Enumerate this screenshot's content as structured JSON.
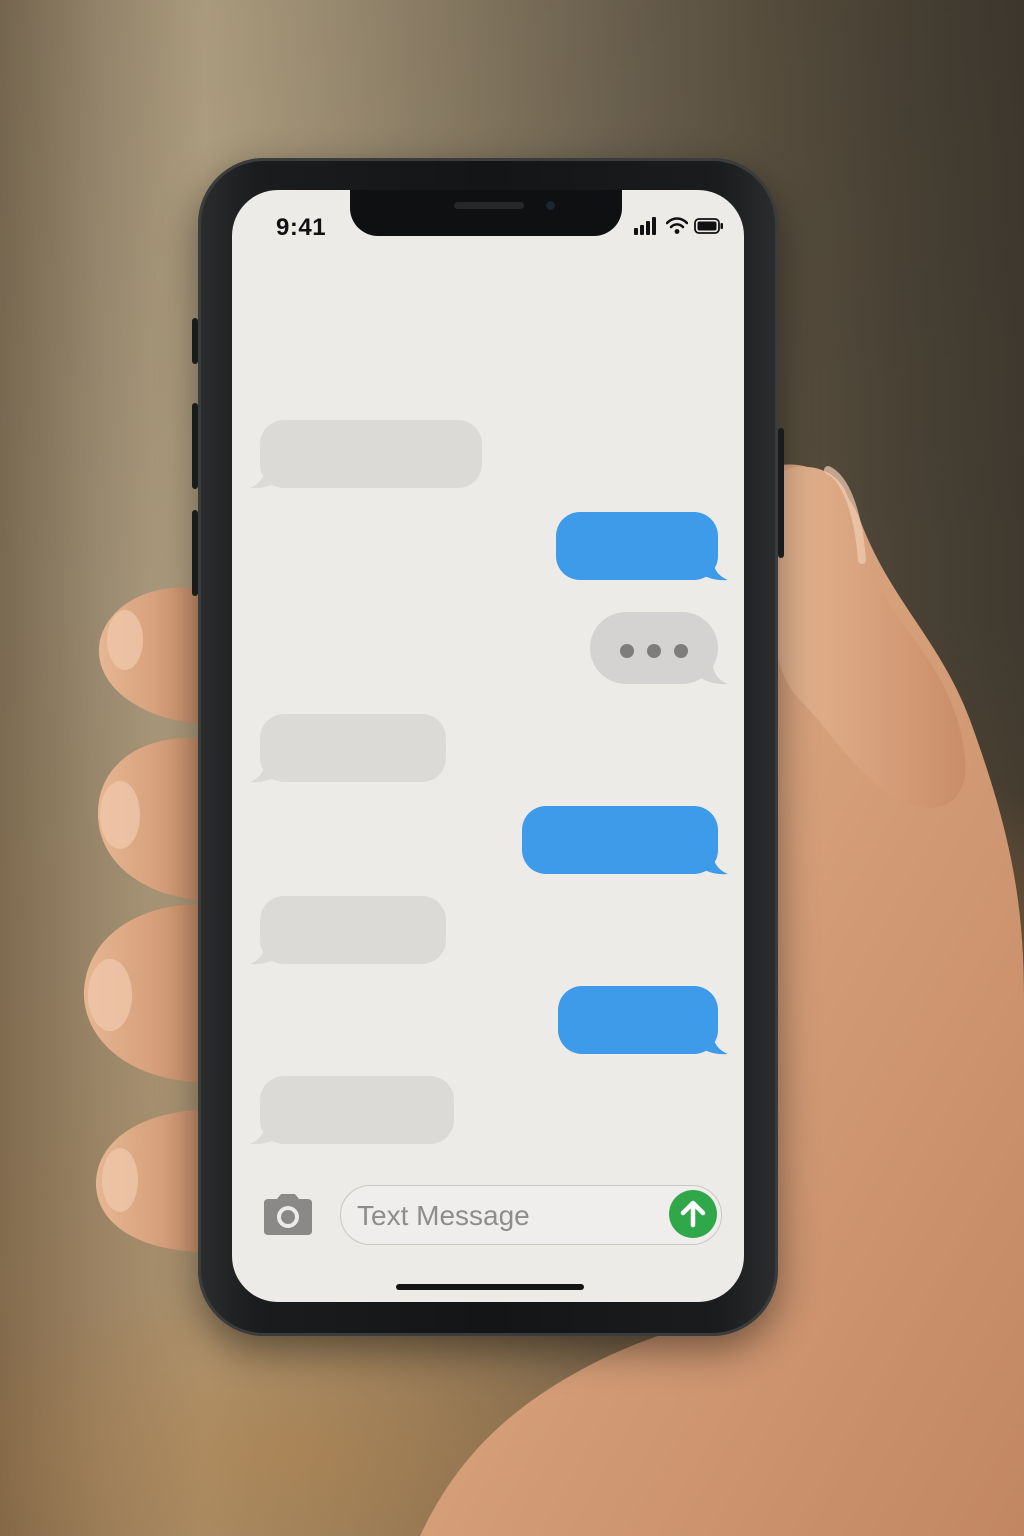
{
  "status_bar": {
    "time": "9:41",
    "icons": [
      "signal-icon",
      "wifi-icon",
      "battery-icon"
    ]
  },
  "conversation": {
    "messages": [
      {
        "side": "incoming",
        "text": ""
      },
      {
        "side": "outgoing",
        "text": ""
      },
      {
        "side": "outgoing",
        "typing_indicator": true
      },
      {
        "side": "incoming",
        "text": ""
      },
      {
        "side": "outgoing",
        "text": ""
      },
      {
        "side": "incoming",
        "text": ""
      },
      {
        "side": "outgoing",
        "text": ""
      },
      {
        "side": "incoming",
        "text": ""
      }
    ]
  },
  "composer": {
    "placeholder": "Text Message",
    "camera_icon": "camera-icon",
    "send_icon": "arrow-up-icon"
  },
  "colors": {
    "outgoing_bubble": "#3d9be9",
    "incoming_bubble": "#dcdad7",
    "send_button": "#30a84a",
    "screen_background": "#edebe8"
  }
}
